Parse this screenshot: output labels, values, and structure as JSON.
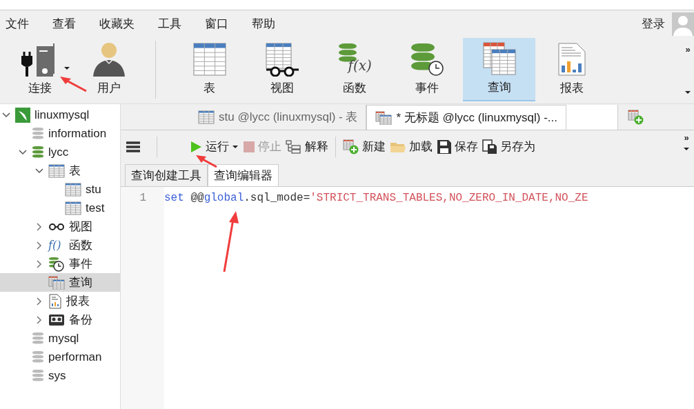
{
  "menu": {
    "items": [
      "文件",
      "查看",
      "收藏夹",
      "工具",
      "窗口",
      "帮助"
    ],
    "login": "登录"
  },
  "toolbar": [
    {
      "kind": "connect",
      "label": "连接",
      "selected": false
    },
    {
      "kind": "user",
      "label": "用户",
      "selected": false
    },
    {
      "kind": "table",
      "label": "表",
      "selected": false
    },
    {
      "kind": "view",
      "label": "视图",
      "selected": false
    },
    {
      "kind": "function",
      "label": "函数",
      "selected": false,
      "icon_text": "f(x)"
    },
    {
      "kind": "event",
      "label": "事件",
      "selected": false
    },
    {
      "kind": "query",
      "label": "查询",
      "selected": true
    },
    {
      "kind": "report",
      "label": "报表",
      "selected": false
    }
  ],
  "toolbar_overflow": "»",
  "query_toolbar_overflow": "»",
  "tree": [
    {
      "kind": "connection",
      "label": "linuxmysql",
      "expanded": true,
      "selected": false,
      "children": [
        {
          "kind": "db",
          "label": "information",
          "open": false,
          "selected": false
        },
        {
          "kind": "db",
          "label": "lycc",
          "open": true,
          "expanded": true,
          "selected": false,
          "children": [
            {
              "kind": "table",
              "label": "表",
              "expanded": true,
              "selected": false,
              "children": [
                {
                  "kind": "table",
                  "label": "stu",
                  "selected": false
                },
                {
                  "kind": "table",
                  "label": "test",
                  "selected": false
                }
              ]
            },
            {
              "kind": "view",
              "label": "视图",
              "expanded": false,
              "selected": false
            },
            {
              "kind": "function",
              "label": "函数",
              "expanded": false,
              "selected": false,
              "icon_text": "f()"
            },
            {
              "kind": "event",
              "label": "事件",
              "expanded": false,
              "selected": false
            },
            {
              "kind": "query",
              "label": "查询",
              "selected": true
            },
            {
              "kind": "report",
              "label": "报表",
              "expanded": false,
              "selected": false
            },
            {
              "kind": "backup",
              "label": "备份",
              "expanded": false,
              "selected": false
            }
          ]
        },
        {
          "kind": "db",
          "label": "mysql",
          "open": false,
          "selected": false
        },
        {
          "kind": "db",
          "label": "performan",
          "open": false,
          "selected": false
        },
        {
          "kind": "db",
          "label": "sys",
          "open": false,
          "selected": false
        }
      ]
    }
  ],
  "tabs": [
    {
      "kind": "table",
      "label": "stu @lycc (linuxmysql) - 表",
      "selected": false
    },
    {
      "kind": "query",
      "label": "* 无标题 @lycc (linuxmysql) -...",
      "selected": true
    }
  ],
  "query_toolbar": [
    {
      "kind": "run",
      "label": "运行",
      "disabled": false
    },
    {
      "kind": "stop",
      "label": "停止",
      "disabled": true
    },
    {
      "kind": "explain",
      "label": "解释",
      "disabled": false
    },
    {
      "kind": "new",
      "label": "新建",
      "disabled": false
    },
    {
      "kind": "load",
      "label": "加载",
      "disabled": false
    },
    {
      "kind": "save",
      "label": "保存",
      "disabled": false
    },
    {
      "kind": "saveas",
      "label": "另存为",
      "disabled": false
    }
  ],
  "subtabs": [
    {
      "label": "查询创建工具",
      "selected": false
    },
    {
      "label": "查询编辑器",
      "selected": true
    }
  ],
  "editor": {
    "lines": [
      {
        "number": "1",
        "tokens": [
          {
            "kind": "keyword",
            "text": "set"
          },
          {
            "kind": "plain",
            "text": " @@"
          },
          {
            "kind": "keyword",
            "text": "global"
          },
          {
            "kind": "plain",
            "text": ".sql_mode="
          },
          {
            "kind": "string",
            "text": "'STRICT_TRANS_TABLES,NO_ZERO_IN_DATE,NO_ZE"
          }
        ]
      }
    ]
  }
}
